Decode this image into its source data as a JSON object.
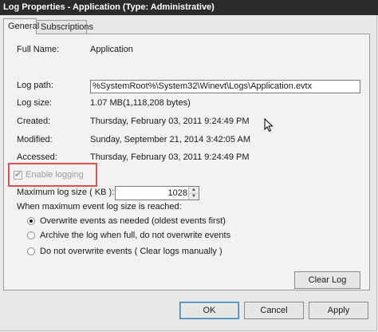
{
  "window": {
    "title": "Log Properties - Application (Type: Administrative)"
  },
  "tabs": [
    {
      "label": "General"
    },
    {
      "label": "Subscriptions"
    }
  ],
  "fields": {
    "full_name_label": "Full Name:",
    "full_name_value": "Application",
    "log_path_label": "Log path:",
    "log_path_value": "%SystemRoot%\\System32\\Winevt\\Logs\\Application.evtx",
    "log_size_label": "Log size:",
    "log_size_value": "1.07 MB(1,118,208 bytes)",
    "created_label": "Created:",
    "created_value": "Thursday, February 03, 2011 9:24:49 PM",
    "modified_label": "Modified:",
    "modified_value": "Sunday, September 21, 2014 3:42:05 AM",
    "accessed_label": "Accessed:",
    "accessed_value": "Thursday, February 03, 2011 9:24:49 PM"
  },
  "enable_logging": {
    "label": "Enable logging",
    "checked": true,
    "disabled": true
  },
  "max_size": {
    "label": "Maximum log size ( KB ):",
    "value": "1028"
  },
  "policy": {
    "heading": "When maximum event log size is reached:",
    "options": [
      {
        "label": "Overwrite events as needed (oldest events first)",
        "selected": true
      },
      {
        "label": "Archive the log when full, do not overwrite events",
        "selected": false
      },
      {
        "label": "Do not overwrite events ( Clear logs manually )",
        "selected": false
      }
    ]
  },
  "buttons": {
    "clear_log": "Clear Log",
    "ok": "OK",
    "cancel": "Cancel",
    "apply": "Apply"
  },
  "colors": {
    "highlight_box": "#e0504f",
    "titlebar": "#2b2b2b"
  }
}
